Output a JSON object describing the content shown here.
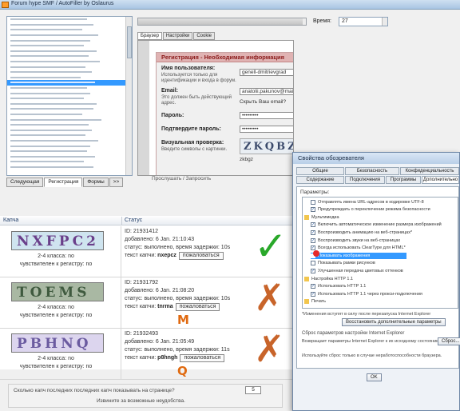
{
  "app": {
    "title": "Forum hype SMF / AutoFiller by Oslaurus"
  },
  "url_list": {
    "rows": 29,
    "selected_index": 12
  },
  "left_tabs": [
    "Следующая",
    "Регистрация",
    "Формы",
    ">>"
  ],
  "progress": 0.98,
  "time_label": "Время:",
  "time_value": "27",
  "browser_tabs": [
    "Браузер",
    "Настройки",
    "Cookie"
  ],
  "form": {
    "header": "Регистрация - Необходимая информация",
    "username_label": "Имя пользователя:",
    "username_hint": "Используется только для идентификации и входа в форум.",
    "username_value": "genell-dmitrievgrad",
    "email_label": "Email:",
    "email_hint": "Это должен быть действующий адрес.",
    "email_value": "anatolii.pakunov@mail.ru",
    "email_hide": "Скрыть Ваш email?",
    "password_label": "Пароль:",
    "password_value": "•••••••••",
    "password2_label": "Подтвердите пароль:",
    "password2_value": "•••••••••",
    "captcha_label": "Визуальная проверка:",
    "captcha_hint": "Введите символы с картинки.",
    "captcha_image_text": "ZKQBZ",
    "captcha_input": "zkbgz",
    "status_text": "Прослушать / Запросить"
  },
  "grid": {
    "col1_header": "Капча",
    "col2_header": "Статус",
    "rows": [
      {
        "captcha_text": "NXFPC2",
        "length_text": "2-4 класса: no",
        "case_text": "чувствителен к регистру: no",
        "id": "ID: 21931412",
        "added": "добавлено: 6 Jan. 21:10:43",
        "status": "статус: выполнено, время задержки: 10s",
        "answer_label": "текст капчи:",
        "answer": "nxepcz",
        "complain": "пожаловаться",
        "verdict": "correct"
      },
      {
        "captcha_text": "TOEMS",
        "length_text": "2-4 класса: no",
        "case_text": "чувствителен к регистру: no",
        "id": "ID: 21931792",
        "added": "добавлено: 6 Jan. 21:08:20",
        "status": "статус: выполнено, время задержки: 10s",
        "answer_label": "текст капчи:",
        "answer": "tnrma",
        "complain": "пожаловаться",
        "verdict": "wrong",
        "correction": "M"
      },
      {
        "captcha_text": "PBHNQ",
        "length_text": "2-4 класса: no",
        "case_text": "чувствителен к регистру: no",
        "id": "ID: 21932493",
        "added": "добавлено: 6 Jan. 21:05:49",
        "status": "статус: выполнено, время задержки: 11s",
        "answer_label": "текст капчи:",
        "answer": "p8hngh",
        "complain": "пожаловаться",
        "verdict": "wrong",
        "correction": "Q"
      }
    ]
  },
  "bottom": {
    "line1": "Сколько капч последних последних капч показывать на странице?",
    "count": "5",
    "line2": "Извините за возможные неудобства."
  },
  "dialog": {
    "title": "Свойства обозревателя",
    "tabs": [
      "Общие",
      "Безопасность",
      "Конфиденциальность",
      "Содержание",
      "Подключения",
      "Программы",
      "Дополнительно"
    ],
    "panel_label": "Параметры:",
    "items": [
      {
        "text": "Отправлять имена URL-адресов в кодировке UTF-8",
        "checked": false
      },
      {
        "text": "Предупреждать о переключении режима безопасности",
        "checked": true
      },
      {
        "text": "Мультимедиа",
        "checked": false,
        "group": true
      },
      {
        "text": "Включить автоматическое изменение размера изображений",
        "checked": true
      },
      {
        "text": "Воспроизводить анимацию на веб-страницах*",
        "checked": true
      },
      {
        "text": "Воспроизводить звуки на веб-страницах",
        "checked": true
      },
      {
        "text": "Всегда использовать ClearType для HTML*",
        "checked": true
      },
      {
        "text": "Показывать изображения",
        "checked": false,
        "highlight": true
      },
      {
        "text": "Показывать рамки рисунков",
        "checked": false
      },
      {
        "text": "Улучшенная передача цветовых оттенков",
        "checked": true
      },
      {
        "text": "Настройка HTTP 1.1",
        "checked": false,
        "group": true
      },
      {
        "text": "Использовать HTTP 1.1",
        "checked": true
      },
      {
        "text": "Использовать HTTP 1.1 через прокси-подключения",
        "checked": true
      },
      {
        "text": "Печать",
        "checked": false,
        "group": true
      }
    ],
    "note": "*Изменения вступят в силу после перезапуска Internet Explorer",
    "restore_button": "Восстановить дополнительные параметры",
    "reset_text": "Сброс параметров настройки Internet Explorer",
    "reset_desc": "Возвращает параметры Internet Explorer к их исходному состоянию.",
    "reset_button": "Сброс...",
    "warning": "Используйте сброс только в случае неработоспособности браузера."
  }
}
